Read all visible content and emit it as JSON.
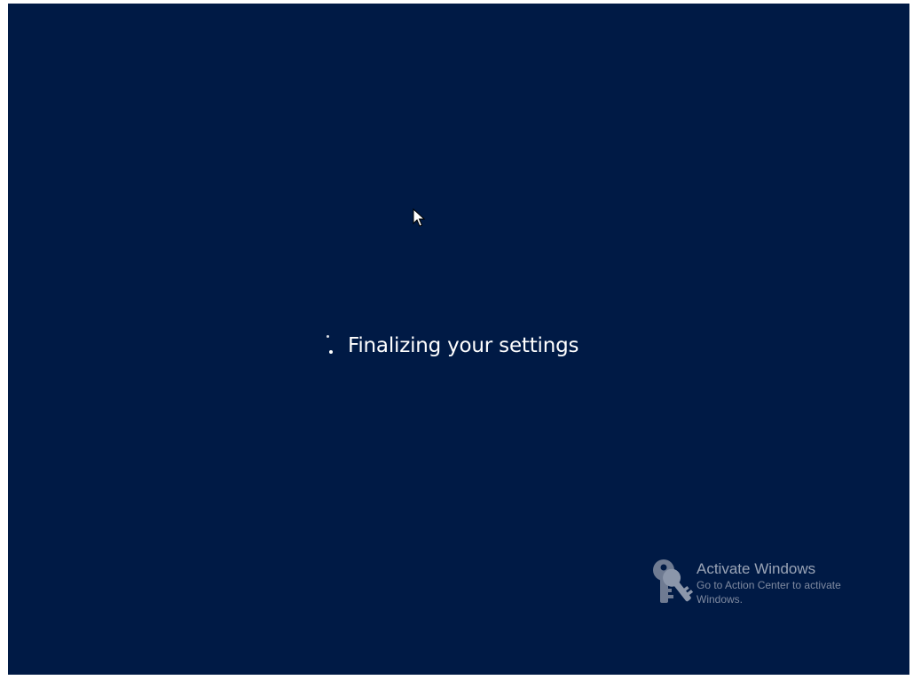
{
  "screen": {
    "background_color": "#001a45",
    "status": {
      "text": "Finalizing your settings",
      "spinner_icon": "loading-dots-icon"
    },
    "cursor_icon": "arrow-cursor-icon"
  },
  "watermark": {
    "icon": "keys-icon",
    "title": "Activate Windows",
    "line1": "Go to Action Center to activate",
    "line2": "Windows."
  }
}
